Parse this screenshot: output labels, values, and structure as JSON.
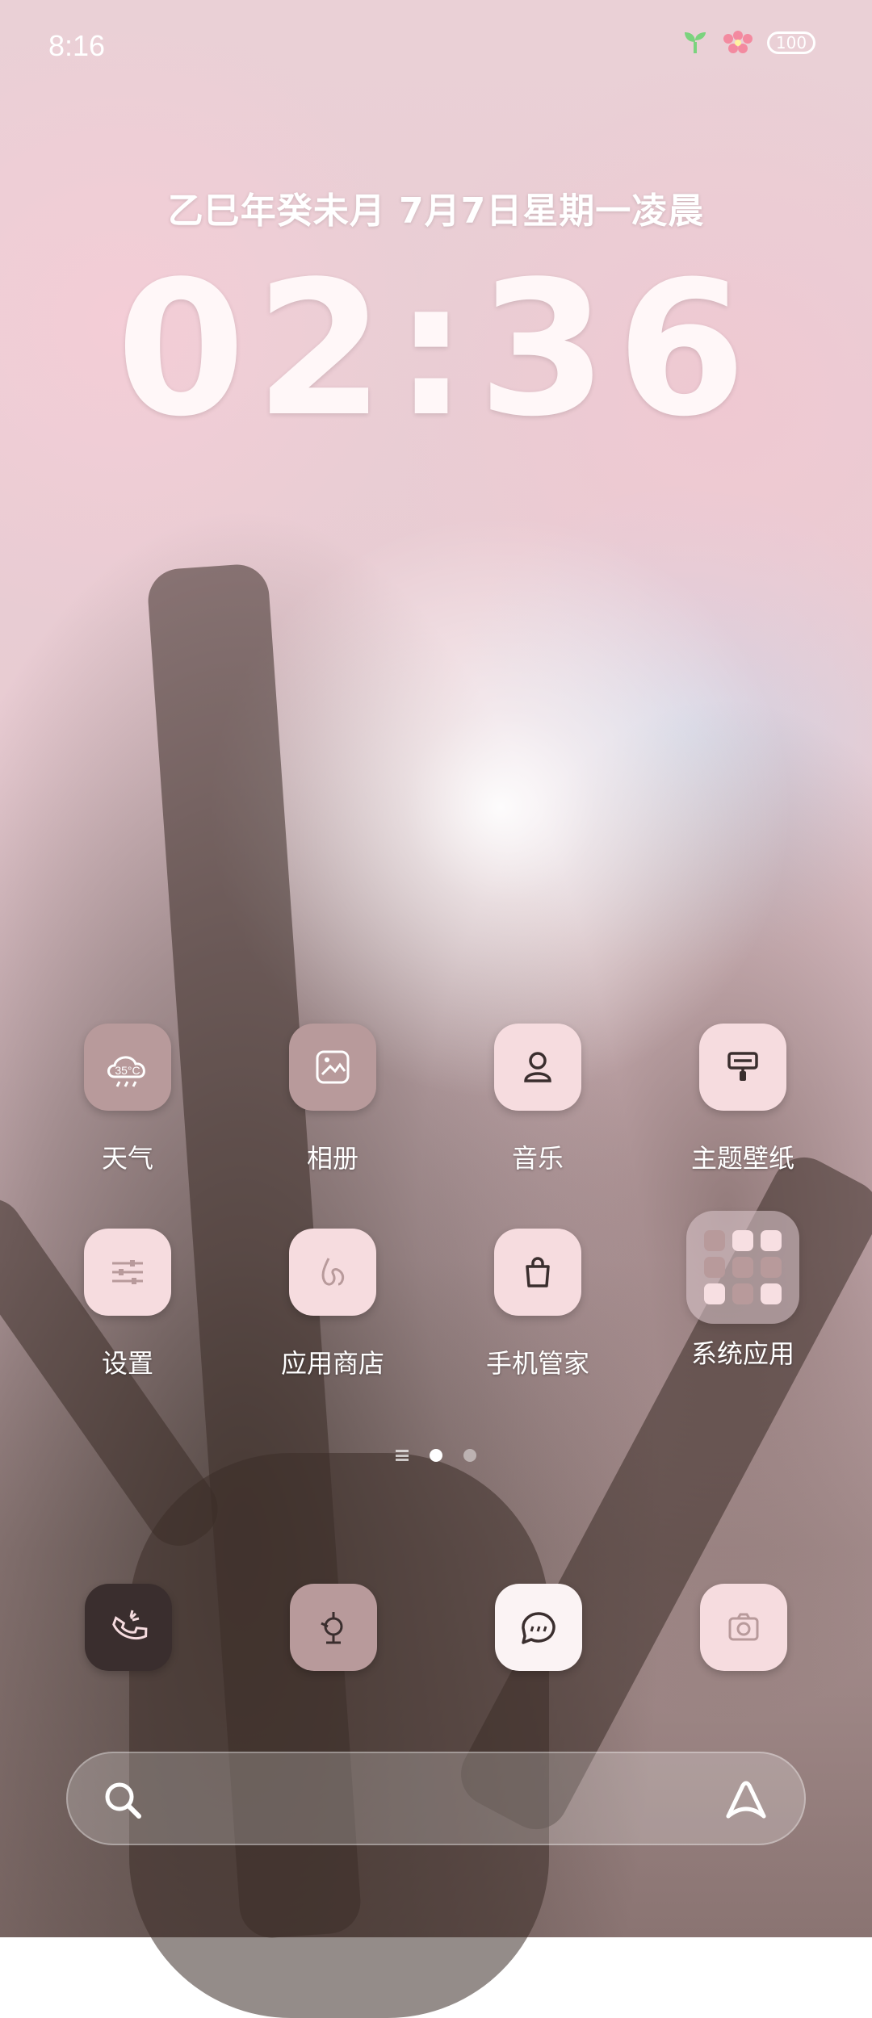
{
  "status_bar": {
    "time": "8:16",
    "battery": "100"
  },
  "lockscreen_widget": {
    "date": "乙巳年癸未月  7月7日星期一凌晨",
    "time": "02:36"
  },
  "apps": [
    {
      "label": "天气",
      "icon": "weather-icon",
      "badge": "35°C"
    },
    {
      "label": "相册",
      "icon": "gallery-icon"
    },
    {
      "label": "音乐",
      "icon": "music-icon"
    },
    {
      "label": "主题壁纸",
      "icon": "theme-icon"
    },
    {
      "label": "设置",
      "icon": "settings-icon"
    },
    {
      "label": "应用商店",
      "icon": "app-store-icon"
    },
    {
      "label": "手机管家",
      "icon": "phone-manager-icon"
    },
    {
      "label": "系统应用",
      "icon": "folder-icon"
    }
  ],
  "page_indicator": {
    "pages": 2,
    "active": 1
  },
  "dock": [
    {
      "icon": "phone-icon"
    },
    {
      "icon": "browser-icon"
    },
    {
      "icon": "messages-icon"
    },
    {
      "icon": "camera-icon"
    }
  ],
  "colors": {
    "icon_mauve": "#b89a9b",
    "icon_pink": "#f6dcdf",
    "icon_dark": "#3a2e2e",
    "icon_white": "#fbf3f4"
  }
}
